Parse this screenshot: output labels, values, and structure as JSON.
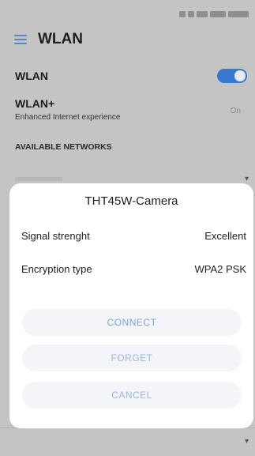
{
  "header": {
    "title": "WLAN"
  },
  "wlan": {
    "label": "WLAN",
    "enabled": true
  },
  "wlan_plus": {
    "label": "WLAN+",
    "subtitle": "Enhanced Internet experience",
    "value": "On"
  },
  "section_title": "AVAILABLE NETWORKS",
  "dialog": {
    "title": "THT45W-Camera",
    "rows": [
      {
        "label": "Signal strenght",
        "value": "Excellent"
      },
      {
        "label": "Encryption type",
        "value": "WPA2 PSK"
      }
    ],
    "buttons": {
      "connect": "CONNECT",
      "forget": "FORGET",
      "cancel": "CANCEL"
    }
  },
  "colors": {
    "accent": "#3b79d1",
    "button_text": "#7fa3d6"
  }
}
